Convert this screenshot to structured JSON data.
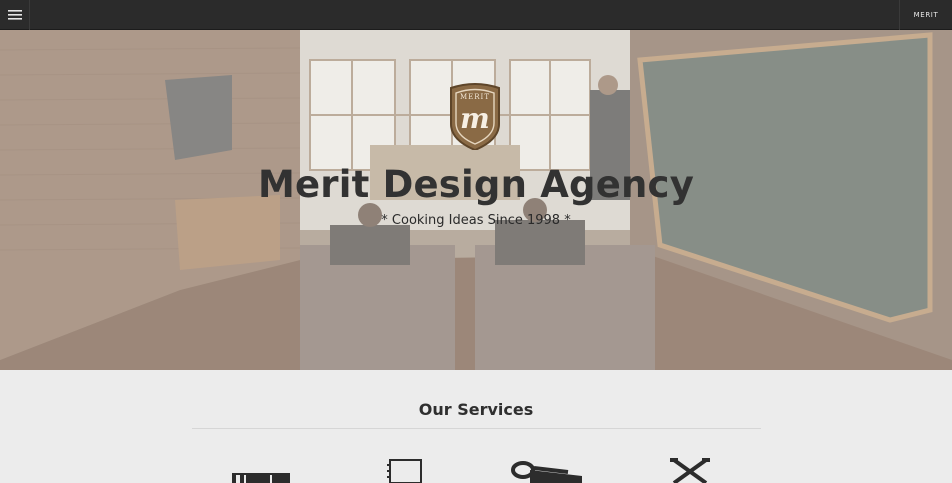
{
  "nav": {
    "menu_icon": "hamburger-icon",
    "brand_label": "MERIT"
  },
  "hero": {
    "logo_text": "MERIT",
    "logo_monogram": "m",
    "title": "Merit Design Agency",
    "tagline": "* Cooking Ideas Since 1998 *"
  },
  "services": {
    "title": "Our Services",
    "icons": [
      "pencil-icon",
      "notebook-icon",
      "scissors-icon",
      "crossed-tools-icon"
    ]
  },
  "colors": {
    "topbar": "#2b2b2b",
    "logo_brown": "#8a6a45",
    "background": "#ececec"
  }
}
